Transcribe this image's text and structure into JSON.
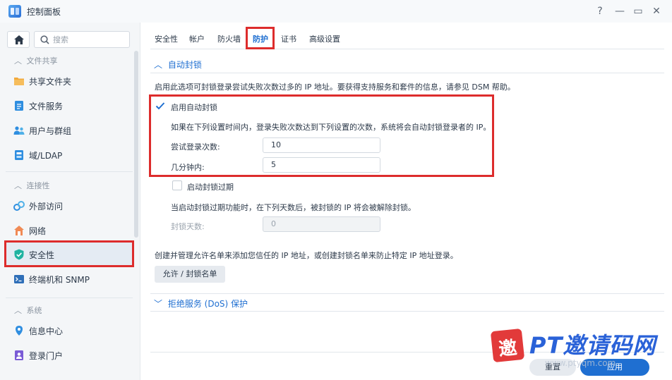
{
  "window": {
    "title": "控制面板",
    "controls": {
      "help": "?",
      "minimize": "—",
      "maximize": "▭",
      "close": "✕"
    }
  },
  "sidebar": {
    "search_placeholder": "搜索",
    "sections": [
      {
        "title": "文件共享",
        "items": [
          {
            "label": "共享文件夹",
            "icon": "shared-folder-icon"
          },
          {
            "label": "文件服务",
            "icon": "file-services-icon"
          },
          {
            "label": "用户与群组",
            "icon": "users-groups-icon"
          },
          {
            "label": "域/LDAP",
            "icon": "domain-ldap-icon"
          }
        ]
      },
      {
        "title": "连接性",
        "items": [
          {
            "label": "外部访问",
            "icon": "external-access-icon"
          },
          {
            "label": "网络",
            "icon": "network-icon"
          },
          {
            "label": "安全性",
            "icon": "security-shield-icon",
            "active": true
          },
          {
            "label": "终端机和 SNMP",
            "icon": "terminal-icon"
          }
        ]
      },
      {
        "title": "系统",
        "items": [
          {
            "label": "信息中心",
            "icon": "info-center-icon"
          },
          {
            "label": "登录门户",
            "icon": "login-portal-icon"
          }
        ]
      }
    ]
  },
  "tabs": [
    {
      "label": "安全性"
    },
    {
      "label": "帐户"
    },
    {
      "label": "防火墙"
    },
    {
      "label": "防护",
      "active": true
    },
    {
      "label": "证书"
    },
    {
      "label": "高级设置"
    }
  ],
  "auto_block": {
    "header": "自动封锁",
    "description": "启用此选项可封锁登录尝试失败次数过多的 IP 地址。要获得支持服务和套件的信息，请参见 DSM 帮助。",
    "enable_label": "启用自动封锁",
    "enabled": true,
    "explain": "如果在下列设置时间内，登录失败次数达到下列设置的次数，系统将会自动封锁登录者的 IP。",
    "attempts_label": "尝试登录次数:",
    "attempts_value": "10",
    "minutes_label": "几分钟内:",
    "minutes_value": "5",
    "expire_label": "启动封锁过期",
    "expire_enabled": false,
    "expire_explain": "当启动封锁过期功能时，在下列天数后，被封锁的 IP 将会被解除封锁。",
    "days_label": "封锁天数:",
    "days_value": "0",
    "allow_block_desc": "创建并管理允许名单来添加您信任的 IP 地址，或创建封锁名单来防止特定 IP 地址登录。",
    "allow_block_button": "允许 / 封锁名单"
  },
  "dos": {
    "header": "拒绝服务 (DoS) 保护"
  },
  "footer": {
    "reset": "重置",
    "apply": "应用"
  },
  "watermark": {
    "badge": "邀",
    "text": "PT邀请码网",
    "url": "www.ptyqm.com"
  },
  "colors": {
    "accent": "#1f6fd1",
    "highlight_box": "#dd2c2c",
    "sidebar_bg": "#f4f6f8"
  }
}
